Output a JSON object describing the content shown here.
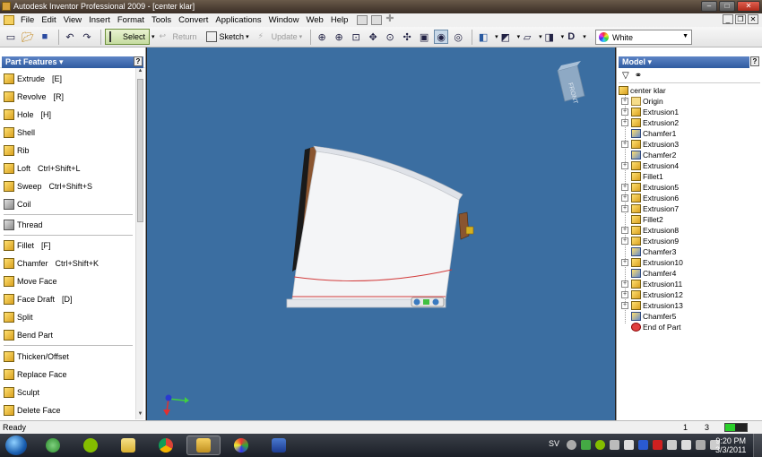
{
  "window": {
    "title": "Autodesk Inventor Professional 2009 - [center klar]"
  },
  "menu": [
    "File",
    "Edit",
    "View",
    "Insert",
    "Format",
    "Tools",
    "Convert",
    "Applications",
    "Window",
    "Web",
    "Help"
  ],
  "toolbar": {
    "select_label": "Select",
    "return_label": "Return",
    "sketch_label": "Sketch",
    "update_label": "Update",
    "color_value": "White"
  },
  "left_panel": {
    "title": "Part Features",
    "features": [
      {
        "label": "Extrude",
        "key": "[E]"
      },
      {
        "label": "Revolve",
        "key": "[R]"
      },
      {
        "label": "Hole",
        "key": "[H]"
      },
      {
        "label": "Shell",
        "key": ""
      },
      {
        "label": "Rib",
        "key": ""
      },
      {
        "label": "Loft",
        "key": "Ctrl+Shift+L"
      },
      {
        "label": "Sweep",
        "key": "Ctrl+Shift+S"
      },
      {
        "label": "Coil",
        "key": ""
      },
      {
        "label": "Thread",
        "key": ""
      },
      {
        "label": "Fillet",
        "key": "[F]"
      },
      {
        "label": "Chamfer",
        "key": "Ctrl+Shift+K"
      },
      {
        "label": "Move Face",
        "key": ""
      },
      {
        "label": "Face Draft",
        "key": "[D]"
      },
      {
        "label": "Split",
        "key": ""
      },
      {
        "label": "Bend Part",
        "key": ""
      },
      {
        "label": "Thicken/Offset",
        "key": ""
      },
      {
        "label": "Replace Face",
        "key": ""
      },
      {
        "label": "Sculpt",
        "key": ""
      },
      {
        "label": "Delete Face",
        "key": ""
      }
    ]
  },
  "viewport": {
    "background": "#3b6ea1",
    "viewcube_label": "FRONT"
  },
  "model_panel": {
    "title": "Model",
    "root": "center klar",
    "items": [
      {
        "label": "Origin",
        "type": "folder",
        "expandable": true
      },
      {
        "label": "Extrusion1",
        "type": "feature",
        "expandable": true
      },
      {
        "label": "Extrusion2",
        "type": "feature",
        "expandable": true
      },
      {
        "label": "Chamfer1",
        "type": "chamfer",
        "expandable": false
      },
      {
        "label": "Extrusion3",
        "type": "feature",
        "expandable": true
      },
      {
        "label": "Chamfer2",
        "type": "chamfer",
        "expandable": false
      },
      {
        "label": "Extrusion4",
        "type": "feature",
        "expandable": true
      },
      {
        "label": "Fillet1",
        "type": "feature",
        "expandable": false
      },
      {
        "label": "Extrusion5",
        "type": "feature",
        "expandable": true
      },
      {
        "label": "Extrusion6",
        "type": "feature",
        "expandable": true
      },
      {
        "label": "Extrusion7",
        "type": "feature",
        "expandable": true
      },
      {
        "label": "Fillet2",
        "type": "feature",
        "expandable": false
      },
      {
        "label": "Extrusion8",
        "type": "feature",
        "expandable": true
      },
      {
        "label": "Extrusion9",
        "type": "feature",
        "expandable": true
      },
      {
        "label": "Chamfer3",
        "type": "chamfer",
        "expandable": false
      },
      {
        "label": "Extrusion10",
        "type": "feature",
        "expandable": true
      },
      {
        "label": "Chamfer4",
        "type": "chamfer",
        "expandable": false
      },
      {
        "label": "Extrusion11",
        "type": "feature",
        "expandable": true
      },
      {
        "label": "Extrusion12",
        "type": "feature",
        "expandable": true
      },
      {
        "label": "Extrusion13",
        "type": "feature",
        "expandable": true
      },
      {
        "label": "Chamfer5",
        "type": "chamfer",
        "expandable": false
      },
      {
        "label": "End of Part",
        "type": "end",
        "expandable": false
      }
    ]
  },
  "status": {
    "text": "Ready",
    "num1": "1",
    "num2": "3"
  },
  "taskbar": {
    "language": "SV",
    "time": "9:20 PM",
    "date": "3/3/2011"
  }
}
